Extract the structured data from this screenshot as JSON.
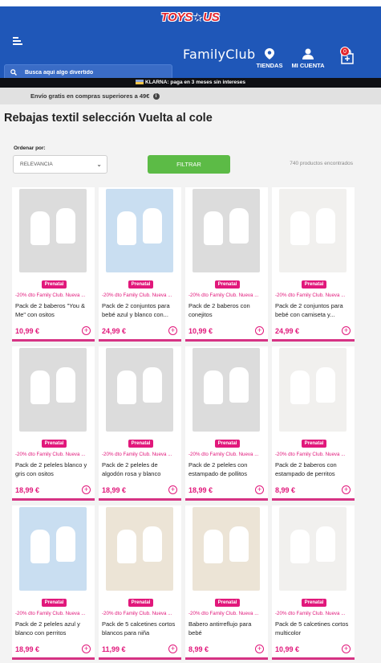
{
  "header": {
    "logo": "TOYS R US",
    "club": "FamilyClub",
    "stores_label": "TIENDAS",
    "account_label": "MI CUENTA",
    "cart_count": "0",
    "search_placeholder": "Busca aquí algo divertido",
    "brand_color": "#1f57b8"
  },
  "banner": {
    "klarna": "KLARNA: paga en 3 meses sin intereses",
    "shipping": "Envío gratis en compras superiores a 49€"
  },
  "page": {
    "title": "Rebajas textil selección Vuelta al cole",
    "sort_label": "Ordenar por:",
    "sort_value": "RELEVANCIA",
    "filter_label": "FILTRAR",
    "results_count": "740 productos encontrados"
  },
  "products": [
    {
      "badge": "Prenatal",
      "promo": "-20% dto Family Club. Nueva ...",
      "name": "Pack de 2 baberos \"You & Me\" con ositos",
      "price": "10,99 €",
      "icon": "bib-icon"
    },
    {
      "badge": "Prenatal",
      "promo": "-20% dto Family Club. Nueva ...",
      "name": "Pack de 2 conjuntos para bebé azul y blanco con...",
      "price": "24,99 €",
      "icon": "outfit-icon"
    },
    {
      "badge": "Prenatal",
      "promo": "-20% dto Family Club. Nueva ...",
      "name": "Pack de 2 baberos con conejitos",
      "price": "10,99 €",
      "icon": "bib-icon"
    },
    {
      "badge": "Prenatal",
      "promo": "-20% dto Family Club. Nueva ...",
      "name": "Pack de 2 conjuntos para bebé con camiseta y...",
      "price": "24,99 €",
      "icon": "outfit-icon"
    },
    {
      "badge": "Prenatal",
      "promo": "-20% dto Family Club. Nueva ...",
      "name": "Pack de 2 peleles blanco y gris con ositos",
      "price": "18,99 €",
      "icon": "onesie-icon"
    },
    {
      "badge": "Prenatal",
      "promo": "-20% dto Family Club. Nueva ...",
      "name": "Pack de 2 peleles de algodón rosa y blanco",
      "price": "18,99 €",
      "icon": "onesie-icon"
    },
    {
      "badge": "Prenatal",
      "promo": "-20% dto Family Club. Nueva ...",
      "name": "Pack de 2 peleles con estampado de pollitos",
      "price": "18,99 €",
      "icon": "onesie-icon"
    },
    {
      "badge": "Prenatal",
      "promo": "-20% dto Family Club. Nueva ...",
      "name": "Pack de 2 baberos con estampado de perritos",
      "price": "8,99 €",
      "icon": "bib-icon"
    },
    {
      "badge": "Prenatal",
      "promo": "-20% dto Family Club. Nueva ...",
      "name": "Pack de 2 peleles azul y blanco con perritos",
      "price": "18,99 €",
      "icon": "onesie-icon"
    },
    {
      "badge": "Prenatal",
      "promo": "-20% dto Family Club. Nueva ...",
      "name": "Pack de 5 calcetines cortos blancos para niña",
      "price": "11,99 €",
      "icon": "socks-icon"
    },
    {
      "badge": "Prenatal",
      "promo": "-20% dto Family Club. Nueva ...",
      "name": "Babero antirreflujo para bebé",
      "price": "8,99 €",
      "icon": "bib-icon"
    },
    {
      "badge": "Prenatal",
      "promo": "-20% dto Family Club. Nueva ...",
      "name": "Pack de 5 calcetines cortos multicolor",
      "price": "10,99 €",
      "icon": "socks-icon"
    }
  ]
}
